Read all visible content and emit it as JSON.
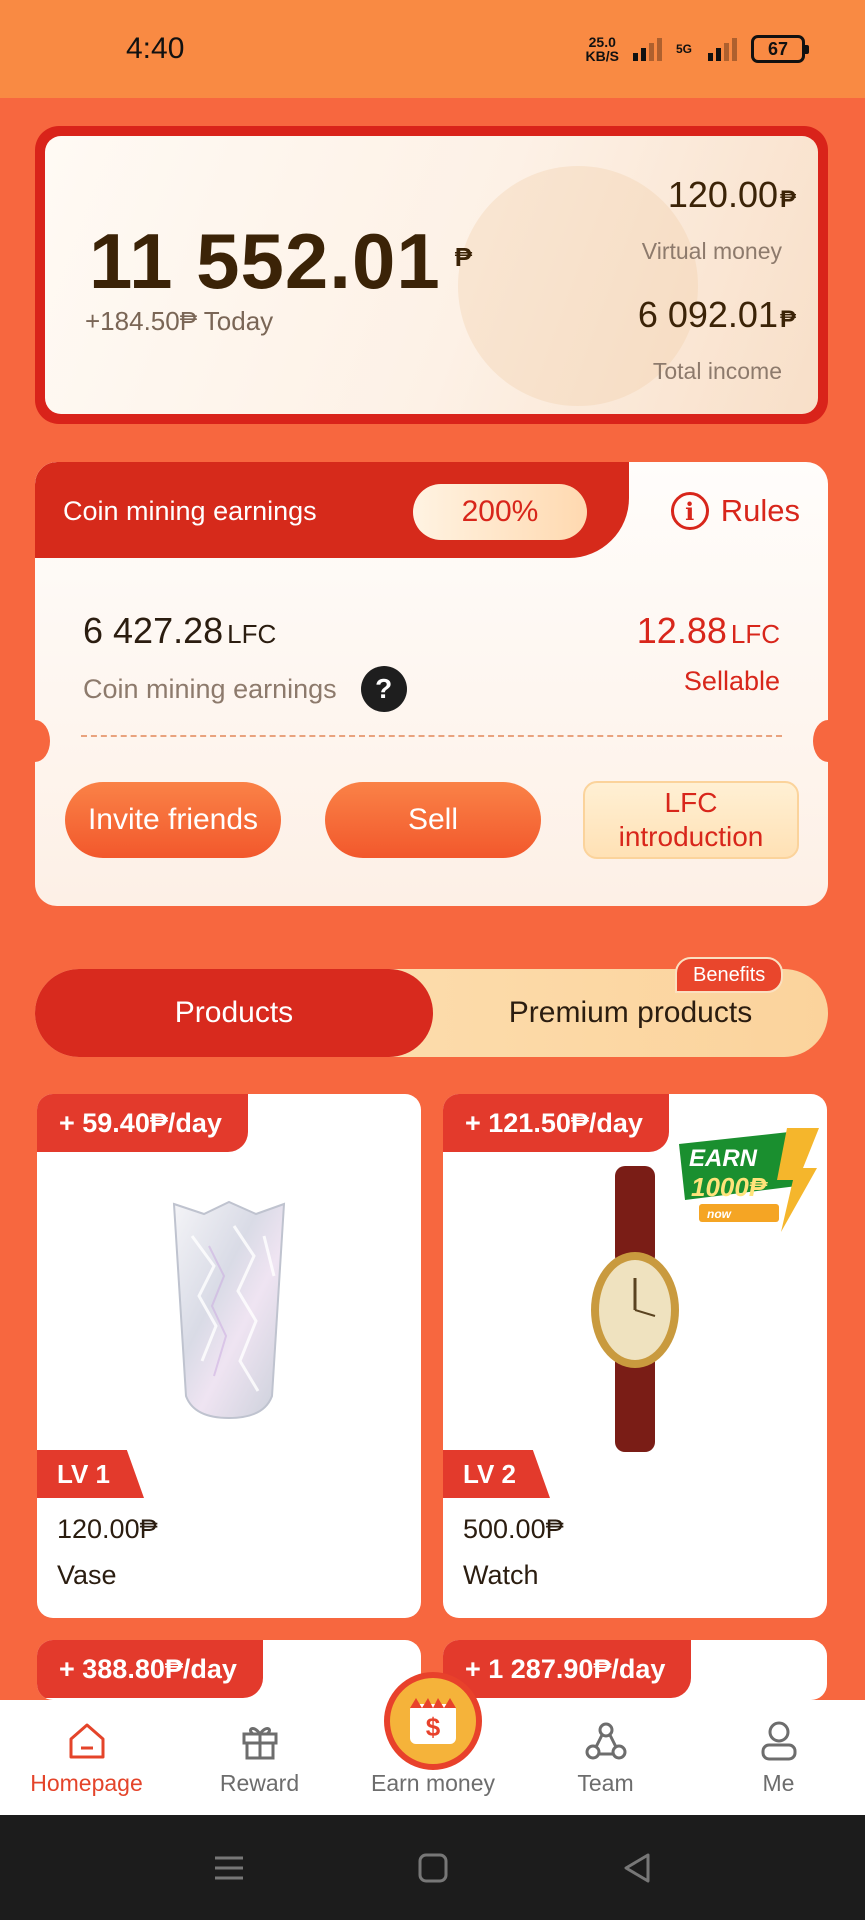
{
  "status_bar": {
    "time": "4:40",
    "net_speed_value": "25.0",
    "net_speed_unit": "KB/S",
    "network_type": "5G",
    "battery": "67"
  },
  "balance": {
    "main_amount": "11 552.01",
    "currency_symbol": "₱",
    "today": "+184.50₱ Today",
    "virtual_money_amount": "120.00",
    "virtual_money_label": "Virtual money",
    "total_income_amount": "6 092.01",
    "total_income_label": "Total income"
  },
  "mining": {
    "title": "Coin mining earnings",
    "percent": "200%",
    "rules_label": "Rules",
    "earnings_value": "6 427.28",
    "earnings_unit": "LFC",
    "earnings_label": "Coin mining earnings",
    "sellable_value": "12.88",
    "sellable_unit": "LFC",
    "sellable_label": "Sellable",
    "buttons": {
      "invite": "Invite friends",
      "sell": "Sell",
      "lfc_intro_line1": "LFC",
      "lfc_intro_line2": "introduction"
    }
  },
  "tabs": {
    "products": "Products",
    "premium": "Premium products",
    "benefits_badge": "Benefits"
  },
  "products": [
    {
      "rate": "+ 59.40₱/day",
      "level": "LV 1",
      "price": "120.00₱",
      "name": "Vase"
    },
    {
      "rate": "+ 121.50₱/day",
      "level": "LV 2",
      "price": "500.00₱",
      "name": "Watch"
    },
    {
      "rate": "+ 388.80₱/day"
    },
    {
      "rate": "+ 1 287.90₱/day"
    }
  ],
  "earn_badge": {
    "line1": "EARN",
    "line2": "1000₱",
    "line3": "now"
  },
  "bottom_nav": {
    "homepage": "Homepage",
    "reward": "Reward",
    "earn_money": "Earn money",
    "team": "Team",
    "me": "Me"
  },
  "colors": {
    "background": "#f7673f",
    "accent_red": "#d8261b",
    "status_bar": "#f98a43"
  }
}
